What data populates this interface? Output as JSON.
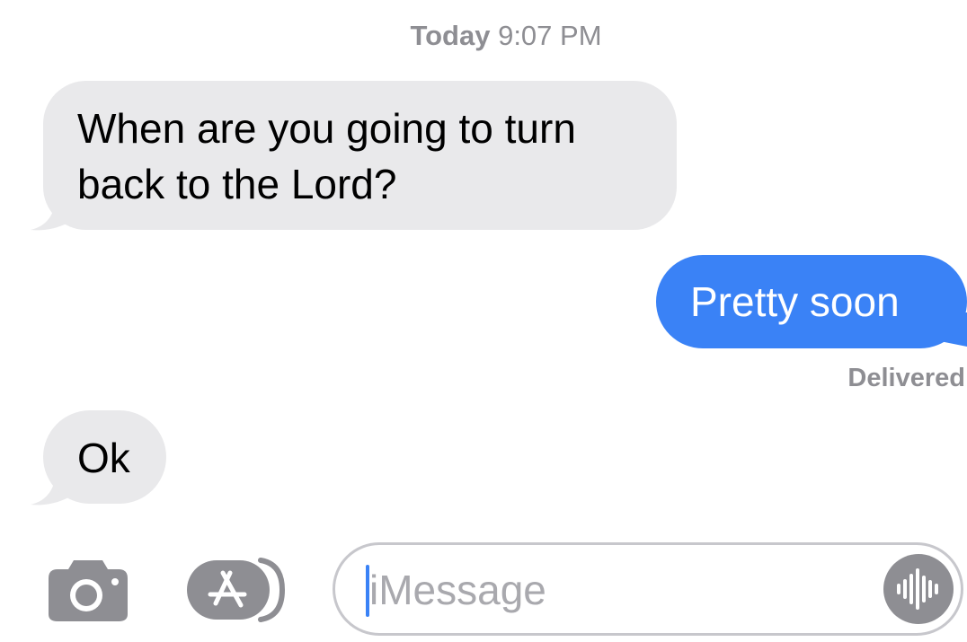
{
  "header": {
    "timestamp_day": "Today",
    "timestamp_time": "9:07 PM"
  },
  "messages": [
    {
      "direction": "incoming",
      "line1": "When are you going to turn",
      "line2": "back to the Lord?"
    },
    {
      "direction": "outgoing",
      "text": "Pretty soon"
    },
    {
      "direction": "incoming",
      "text": "Ok"
    }
  ],
  "status": {
    "delivered": "Delivered"
  },
  "composer": {
    "placeholder": "iMessage",
    "camera_icon": "camera-icon",
    "apps_icon": "app-store-icon",
    "audio_icon": "audio-waveform-icon"
  },
  "colors": {
    "incoming_bubble": "#e9e9eb",
    "outgoing_bubble": "#3a82f6",
    "secondary_text": "#8e8e93",
    "icon_gray": "#8e8e93"
  }
}
